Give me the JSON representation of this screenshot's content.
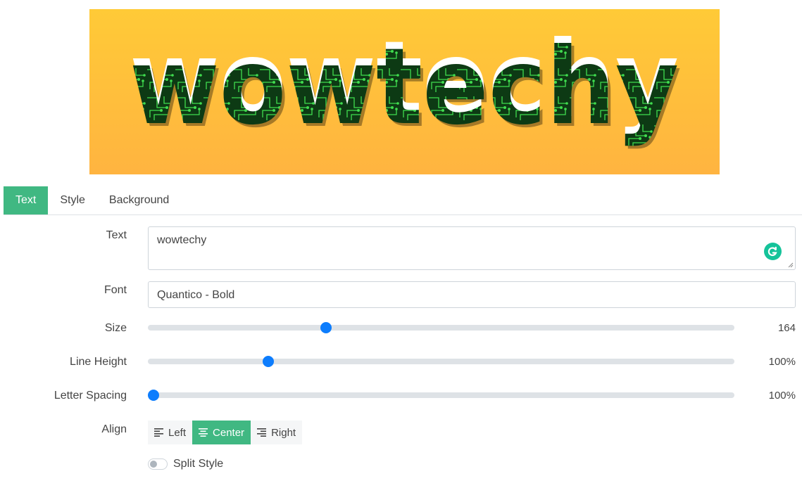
{
  "preview": {
    "text": "wowtechy"
  },
  "tabs": [
    {
      "label": "Text",
      "active": true
    },
    {
      "label": "Style",
      "active": false
    },
    {
      "label": "Background",
      "active": false
    }
  ],
  "form": {
    "text": {
      "label": "Text",
      "value": "wowtechy"
    },
    "font": {
      "label": "Font",
      "value": "Quantico - Bold"
    },
    "size": {
      "label": "Size",
      "value": "164",
      "fraction": 0.304
    },
    "line_height": {
      "label": "Line Height",
      "value": "100%",
      "fraction": 0.205
    },
    "letter_spacing": {
      "label": "Letter Spacing",
      "value": "100%",
      "fraction": 0.01
    },
    "align": {
      "label": "Align",
      "options": [
        {
          "label": "Left",
          "icon": "align-left-icon",
          "active": false
        },
        {
          "label": "Center",
          "icon": "align-center-icon",
          "active": true
        },
        {
          "label": "Right",
          "icon": "align-right-icon",
          "active": false
        }
      ]
    },
    "split_style": {
      "label": "Split Style",
      "on": false
    }
  },
  "colors": {
    "accent": "#40b882",
    "slider_thumb": "#0d7dfd",
    "grammarly": "#15c39a",
    "preview_top": "#ffca37",
    "preview_bottom": "#ffb440"
  },
  "icons": {
    "grammarly": "grammarly-icon"
  }
}
